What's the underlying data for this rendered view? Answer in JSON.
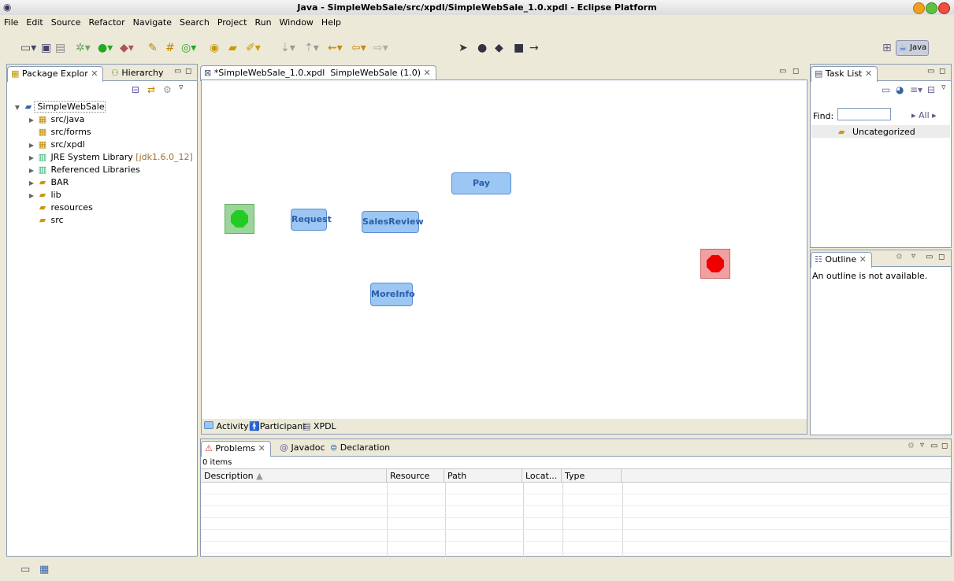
{
  "window": {
    "title": "Java - SimpleWebSale/src/xpdl/SimpleWebSale_1.0.xpdl - Eclipse Platform"
  },
  "menu": [
    "File",
    "Edit",
    "Source",
    "Refactor",
    "Navigate",
    "Search",
    "Project",
    "Run",
    "Window",
    "Help"
  ],
  "perspective": {
    "label": "Java"
  },
  "left": {
    "tabs": [
      "Package Explor",
      "Hierarchy"
    ],
    "tree": [
      {
        "label": "SimpleWebSale",
        "indent": 0,
        "expanded": true,
        "kind": "project"
      },
      {
        "label": "src/java",
        "indent": 1,
        "kind": "pkg"
      },
      {
        "label": "src/forms",
        "indent": 1,
        "kind": "pkg"
      },
      {
        "label": "src/xpdl",
        "indent": 1,
        "kind": "pkg"
      },
      {
        "label": "JRE System Library",
        "suffix": "[jdk1.6.0_12]",
        "indent": 1,
        "kind": "lib"
      },
      {
        "label": "Referenced Libraries",
        "indent": 1,
        "kind": "lib"
      },
      {
        "label": "BAR",
        "indent": 1,
        "kind": "folder"
      },
      {
        "label": "lib",
        "indent": 1,
        "kind": "folder"
      },
      {
        "label": "resources",
        "indent": 1,
        "kind": "folder"
      },
      {
        "label": "src",
        "indent": 1,
        "kind": "folder"
      }
    ]
  },
  "editor": {
    "tab": "*SimpleWebSale_1.0.xpdl  SimpleWebSale (1.0)",
    "nodes": {
      "pay": "Pay",
      "request": "Request",
      "salesreview": "SalesReview",
      "moreinfo": "MoreInfo"
    },
    "bottom_tabs": [
      "Activity",
      "Participant",
      "XPDL"
    ]
  },
  "tasklist": {
    "tab": "Task List",
    "find_label": "Find:",
    "find_value": "",
    "all_label": "All",
    "category": "Uncategorized"
  },
  "outline": {
    "tab": "Outline",
    "message": "An outline is not available."
  },
  "problems": {
    "tabs": [
      "Problems",
      "Javadoc",
      "Declaration"
    ],
    "count": "0 items",
    "columns": [
      "Description",
      "Resource",
      "Path",
      "Locat...",
      "Type"
    ]
  },
  "colors": {
    "start": "#22cc22",
    "end": "#ee0000",
    "node_fill": "#9cc6f3"
  }
}
